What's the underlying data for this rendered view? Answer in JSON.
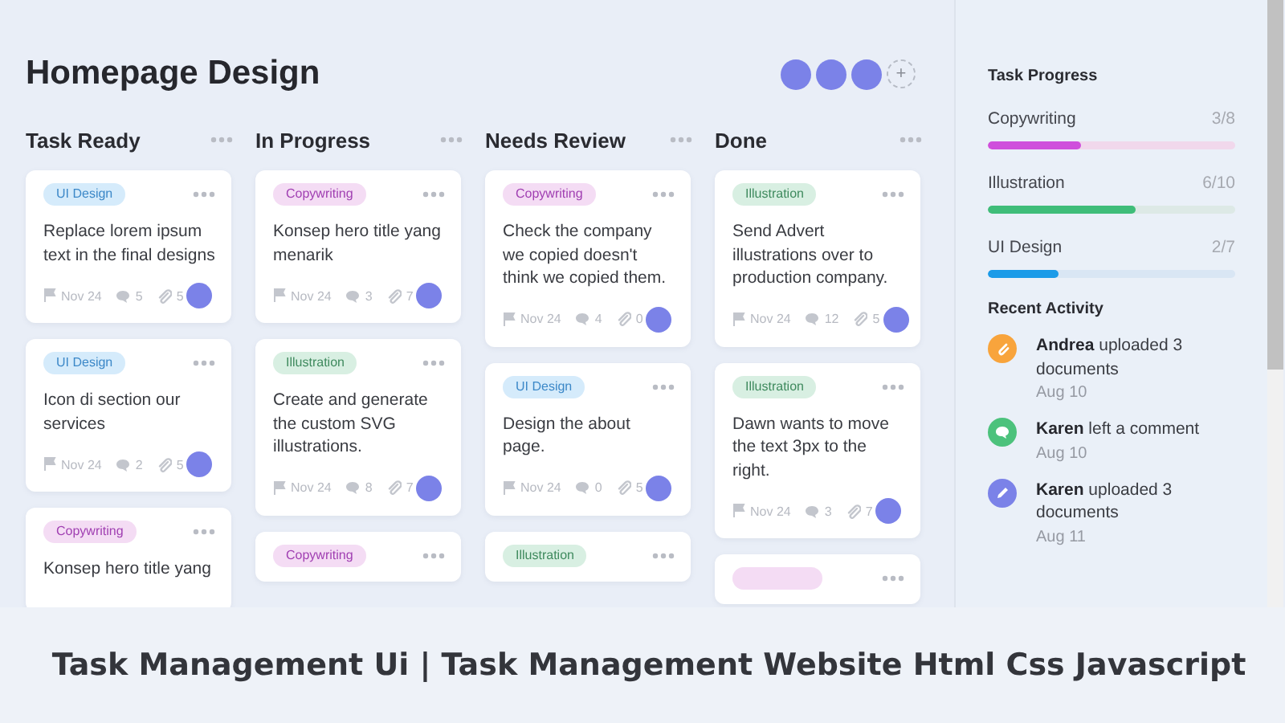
{
  "board": {
    "title": "Homepage Design",
    "members": [
      {
        "kind": "avatar"
      },
      {
        "kind": "avatar"
      },
      {
        "kind": "avatar"
      }
    ],
    "add_member": "+"
  },
  "columns": [
    {
      "title": "Task Ready",
      "cards": [
        {
          "tag": {
            "label": "UI Design",
            "kind": "ui"
          },
          "text": "Replace lorem ipsum text in the final designs",
          "due": "Nov 24",
          "comments": "5",
          "attachments": "5"
        },
        {
          "tag": {
            "label": "UI Design",
            "kind": "ui"
          },
          "text": "Icon di section our services",
          "due": "Nov 24",
          "comments": "2",
          "attachments": "5"
        },
        {
          "tag": {
            "label": "Copywriting",
            "kind": "copy"
          },
          "text": "Konsep hero title yang"
        }
      ]
    },
    {
      "title": "In Progress",
      "cards": [
        {
          "tag": {
            "label": "Copywriting",
            "kind": "copy"
          },
          "text": "Konsep hero title yang menarik",
          "due": "Nov 24",
          "comments": "3",
          "attachments": "7"
        },
        {
          "tag": {
            "label": "Illustration",
            "kind": "illu"
          },
          "text": "Create and generate the custom SVG illustrations.",
          "due": "Nov 24",
          "comments": "8",
          "attachments": "7"
        },
        {
          "tag": {
            "label": "Copywriting",
            "kind": "copy"
          }
        }
      ]
    },
    {
      "title": "Needs Review",
      "cards": [
        {
          "tag": {
            "label": "Copywriting",
            "kind": "copy"
          },
          "text": "Check the company we copied doesn't think we copied them.",
          "due": "Nov 24",
          "comments": "4",
          "attachments": "0"
        },
        {
          "tag": {
            "label": "UI Design",
            "kind": "ui"
          },
          "text": "Design the about page.",
          "due": "Nov 24",
          "comments": "0",
          "attachments": "5"
        },
        {
          "tag": {
            "label": "Illustration",
            "kind": "illu"
          }
        }
      ]
    },
    {
      "title": "Done",
      "cards": [
        {
          "tag": {
            "label": "Illustration",
            "kind": "illu"
          },
          "text": "Send Advert illustrations over to production company.",
          "due": "Nov 24",
          "comments": "12",
          "attachments": "5"
        },
        {
          "tag": {
            "label": "Illustration",
            "kind": "illu"
          },
          "text": "Dawn wants to move the text 3px to the right.",
          "due": "Nov 24",
          "comments": "3",
          "attachments": "7"
        },
        {
          "tag": {
            "kind": "copy"
          }
        }
      ]
    }
  ],
  "sidebar": {
    "progress": {
      "title": "Task Progress",
      "items": [
        {
          "label": "Copywriting",
          "count": "3/8",
          "level": 0.375,
          "kind": "copy"
        },
        {
          "label": "Illustration",
          "count": "6/10",
          "level": 0.6,
          "kind": "illu"
        },
        {
          "label": "UI Design",
          "count": "2/7",
          "level": 0.286,
          "kind": "ui"
        }
      ]
    },
    "activity": {
      "title": "Recent Activity",
      "items": [
        {
          "kind": "upload",
          "text": "**Andrea** uploaded 3 documents",
          "date": "Aug 10"
        },
        {
          "kind": "comment",
          "text": "**Karen** left a comment",
          "date": "Aug 10"
        },
        {
          "kind": "edit",
          "text": "**Karen** uploaded 3 documents",
          "date": "Aug 11"
        }
      ]
    }
  },
  "caption": "Task Management Ui | Task Management Website Html Css Javascript"
}
